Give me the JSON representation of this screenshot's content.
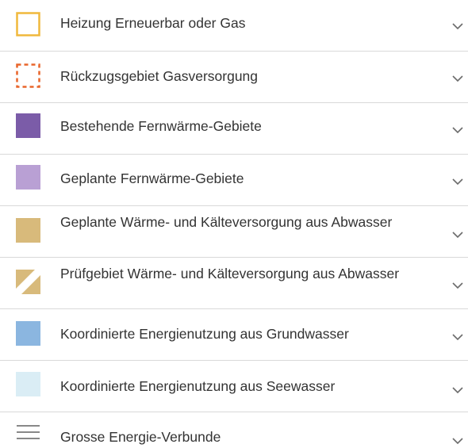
{
  "legend": {
    "items": [
      {
        "label": "Heizung Erneuerbar oder Gas",
        "icon": "square-outline-yellow-icon",
        "color": "#f0b83c"
      },
      {
        "label": "Rückzugsgebiet Gasversorgung",
        "icon": "square-dashed-orange-icon",
        "color": "#e9652a"
      },
      {
        "label": "Bestehende Fernwärme-Gebiete",
        "icon": "square-filled-purple-icon",
        "color": "#7b5ca8"
      },
      {
        "label": "Geplante Fernwärme-Gebiete",
        "icon": "square-filled-lilac-icon",
        "color": "#b9a0d4"
      },
      {
        "label": "Geplante Wärme- und Kälteversorgung aus Abwasser",
        "icon": "square-filled-tan-icon",
        "color": "#d8ba7b"
      },
      {
        "label": "Prüfgebiet Wärme- und Kälteversorgung aus Abwasser",
        "icon": "square-hatched-tan-icon",
        "color": "#d8ba7b"
      },
      {
        "label": "Koordinierte Energienutzung aus Grundwasser",
        "icon": "square-filled-blue-icon",
        "color": "#8bb6e0"
      },
      {
        "label": "Koordinierte Energienutzung aus Seewasser",
        "icon": "square-filled-lightblue-icon",
        "color": "#daedf5"
      },
      {
        "label": "Grosse Energie-Verbunde",
        "icon": "three-lines-gray-icon",
        "color": "#888888"
      }
    ],
    "expand_icon": "chevron-down-icon"
  }
}
